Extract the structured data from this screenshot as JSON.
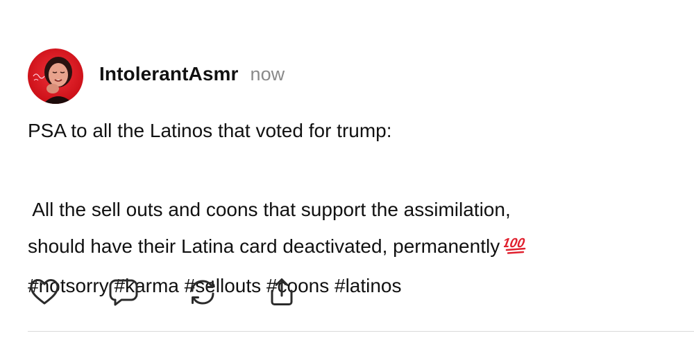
{
  "post": {
    "author": {
      "username": "IntolerantAsmr",
      "timestamp": "now"
    },
    "body": {
      "paragraph_1": "PSA to all the Latinos that voted for trump:",
      "paragraph_2_lines": [
        " All the sell outs and coons that support the assimilation,",
        "should have their Latina card deactivated, permanently",
        "#notsorry #karma #sellouts #coons #latinos"
      ]
    },
    "emoji": "hundred-points",
    "actions": [
      {
        "name": "like",
        "icon": "heart-icon"
      },
      {
        "name": "reply",
        "icon": "comment-icon"
      },
      {
        "name": "repost",
        "icon": "repost-icon"
      },
      {
        "name": "share",
        "icon": "share-icon"
      }
    ],
    "colors": {
      "text": "#111111",
      "timestamp": "#8a8a8a",
      "icon_stroke": "#2b2b2b",
      "divider": "#d9d9d9",
      "emoji_red": "#e0202e",
      "avatar_bg": "#e1121b"
    }
  }
}
